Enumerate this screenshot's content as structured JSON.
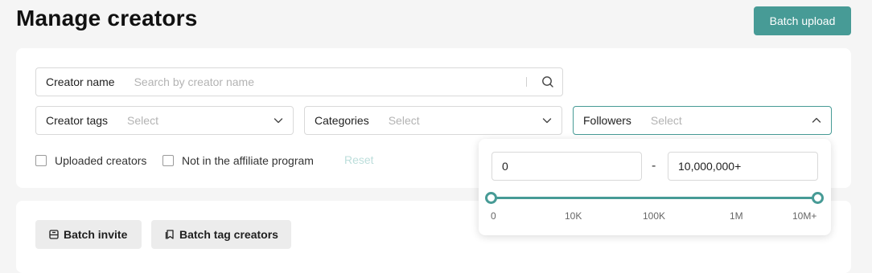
{
  "header": {
    "title": "Manage creators",
    "batch_upload_label": "Batch upload"
  },
  "filters": {
    "creator_name": {
      "label": "Creator name",
      "placeholder": "Search by creator name"
    },
    "creator_tags": {
      "label": "Creator tags",
      "placeholder": "Select"
    },
    "categories": {
      "label": "Categories",
      "placeholder": "Select"
    },
    "followers": {
      "label": "Followers",
      "placeholder": "Select",
      "expanded": true
    },
    "checkboxes": [
      {
        "label": "Uploaded creators",
        "checked": false
      },
      {
        "label": "Not in the affiliate program",
        "checked": false
      }
    ],
    "reset_label": "Reset"
  },
  "followers_popup": {
    "min_value": "0",
    "separator": "-",
    "max_value": "10,000,000+",
    "range": [
      0,
      1
    ],
    "ticks": [
      "0",
      "10K",
      "100K",
      "1M",
      "10M+"
    ]
  },
  "actions": {
    "batch_invite_label": "Batch invite",
    "batch_tag_label": "Batch tag creators"
  },
  "colors": {
    "accent": "#479b96",
    "background": "#f5f5f5"
  }
}
